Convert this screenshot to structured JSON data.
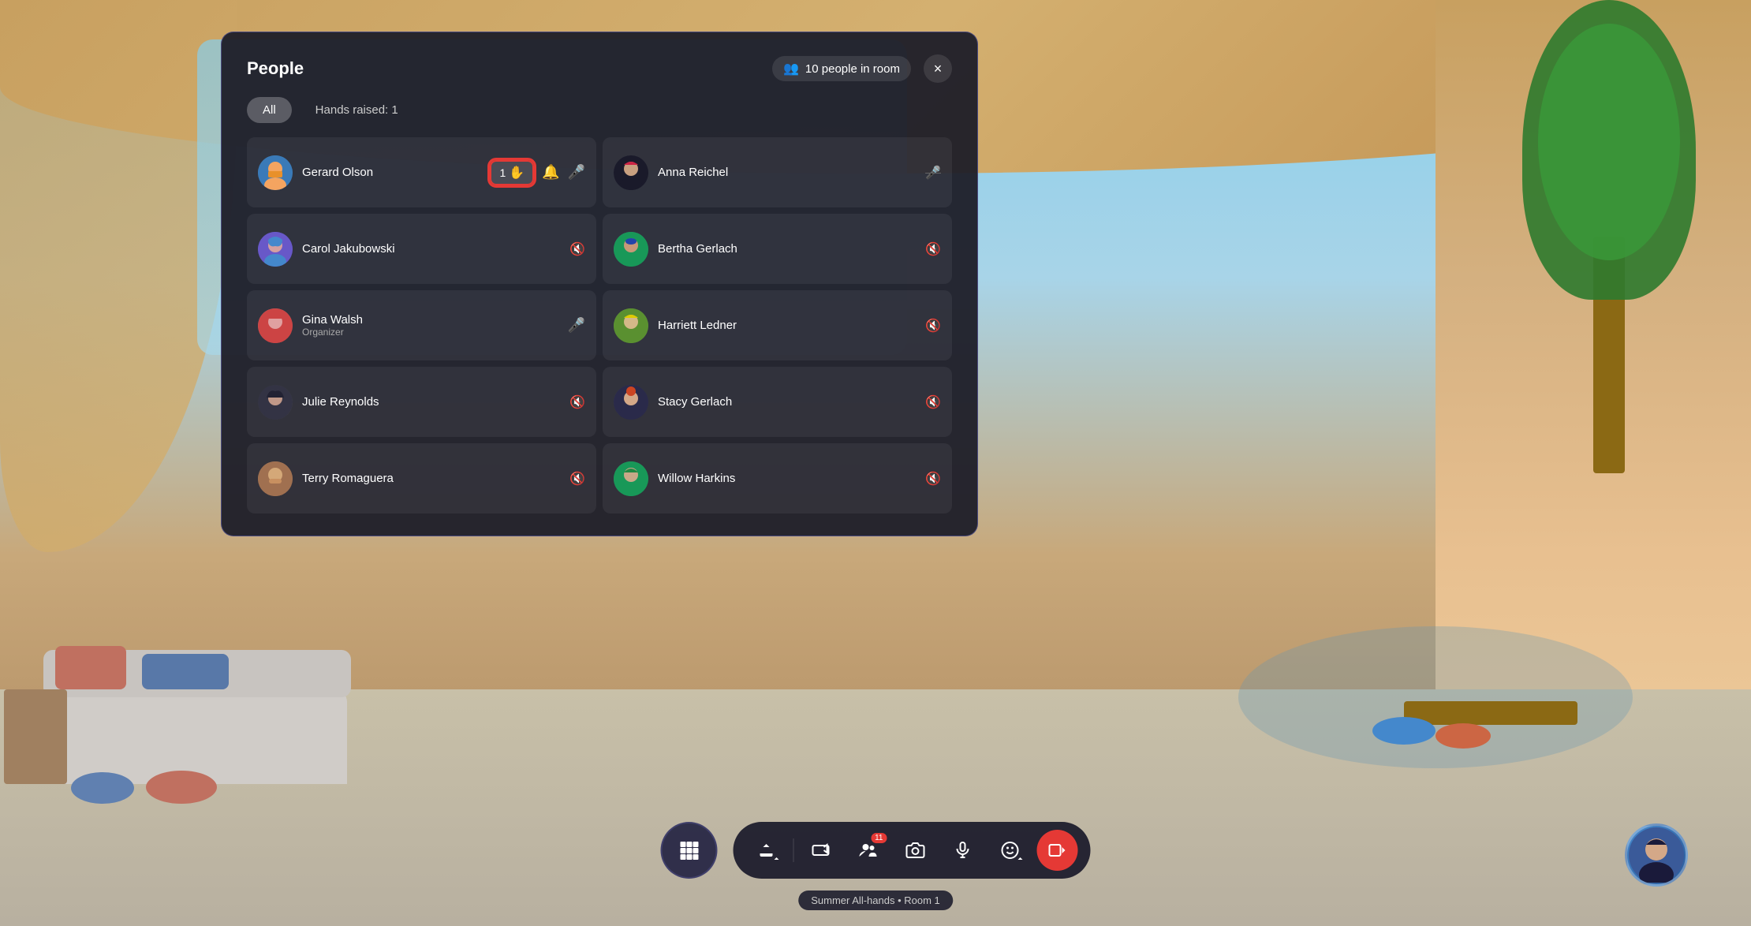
{
  "background": {
    "color": "#87CEEB"
  },
  "panel": {
    "title": "People",
    "close_label": "×",
    "people_count_label": "10 people in room",
    "tabs": [
      {
        "id": "all",
        "label": "All",
        "active": true
      },
      {
        "id": "hands",
        "label": "Hands raised: 1",
        "active": false
      }
    ],
    "people": [
      {
        "id": "gerard",
        "name": "Gerard Olson",
        "role": "",
        "avatar_class": "av-gerard",
        "avatar_emoji": "🧑",
        "has_hand_raised": true,
        "hand_count": "1",
        "has_mic": true,
        "mic_active": true,
        "mic_muted": false,
        "col": 0
      },
      {
        "id": "anna",
        "name": "Anna Reichel",
        "role": "",
        "avatar_class": "av-anna",
        "avatar_emoji": "👩",
        "has_hand_raised": false,
        "mic_muted": true,
        "col": 1
      },
      {
        "id": "carol",
        "name": "Carol Jakubowski",
        "role": "",
        "avatar_class": "av-carol",
        "avatar_emoji": "👩",
        "has_hand_raised": false,
        "mic_muted": true,
        "col": 0
      },
      {
        "id": "bertha",
        "name": "Bertha Gerlach",
        "role": "",
        "avatar_class": "av-bertha",
        "avatar_emoji": "👩",
        "has_hand_raised": false,
        "mic_muted": true,
        "col": 1
      },
      {
        "id": "gina",
        "name": "Gina Walsh",
        "role": "Organizer",
        "avatar_class": "av-gina",
        "avatar_emoji": "👩",
        "has_hand_raised": false,
        "mic_muted": false,
        "mic_active": true,
        "col": 0
      },
      {
        "id": "harriett",
        "name": "Harriett Ledner",
        "role": "",
        "avatar_class": "av-harriett",
        "avatar_emoji": "👩",
        "has_hand_raised": false,
        "mic_muted": true,
        "col": 1
      },
      {
        "id": "julie",
        "name": "Julie Reynolds",
        "role": "",
        "avatar_class": "av-julie",
        "avatar_emoji": "👩",
        "has_hand_raised": false,
        "mic_muted": true,
        "col": 0
      },
      {
        "id": "stacy",
        "name": "Stacy Gerlach",
        "role": "",
        "avatar_class": "av-stacy",
        "avatar_emoji": "👩",
        "has_hand_raised": false,
        "mic_muted": true,
        "col": 1
      },
      {
        "id": "terry",
        "name": "Terry Romaguera",
        "role": "",
        "avatar_class": "av-terry",
        "avatar_emoji": "🧔",
        "has_hand_raised": false,
        "mic_muted": true,
        "col": 0
      },
      {
        "id": "willow",
        "name": "Willow Harkins",
        "role": "",
        "avatar_class": "av-willow",
        "avatar_emoji": "👩",
        "has_hand_raised": false,
        "mic_muted": true,
        "col": 1
      }
    ]
  },
  "toolbar": {
    "grid_btn_label": "⊞",
    "share_btn_label": "↑",
    "film_btn_label": "🎬",
    "people_btn_label": "👥",
    "people_count": "11",
    "camera_btn_label": "📷",
    "mic_btn_label": "🎤",
    "emoji_btn_label": "🙂",
    "leave_btn_label": "📵",
    "session_label": "Summer All-hands • Room 1"
  }
}
